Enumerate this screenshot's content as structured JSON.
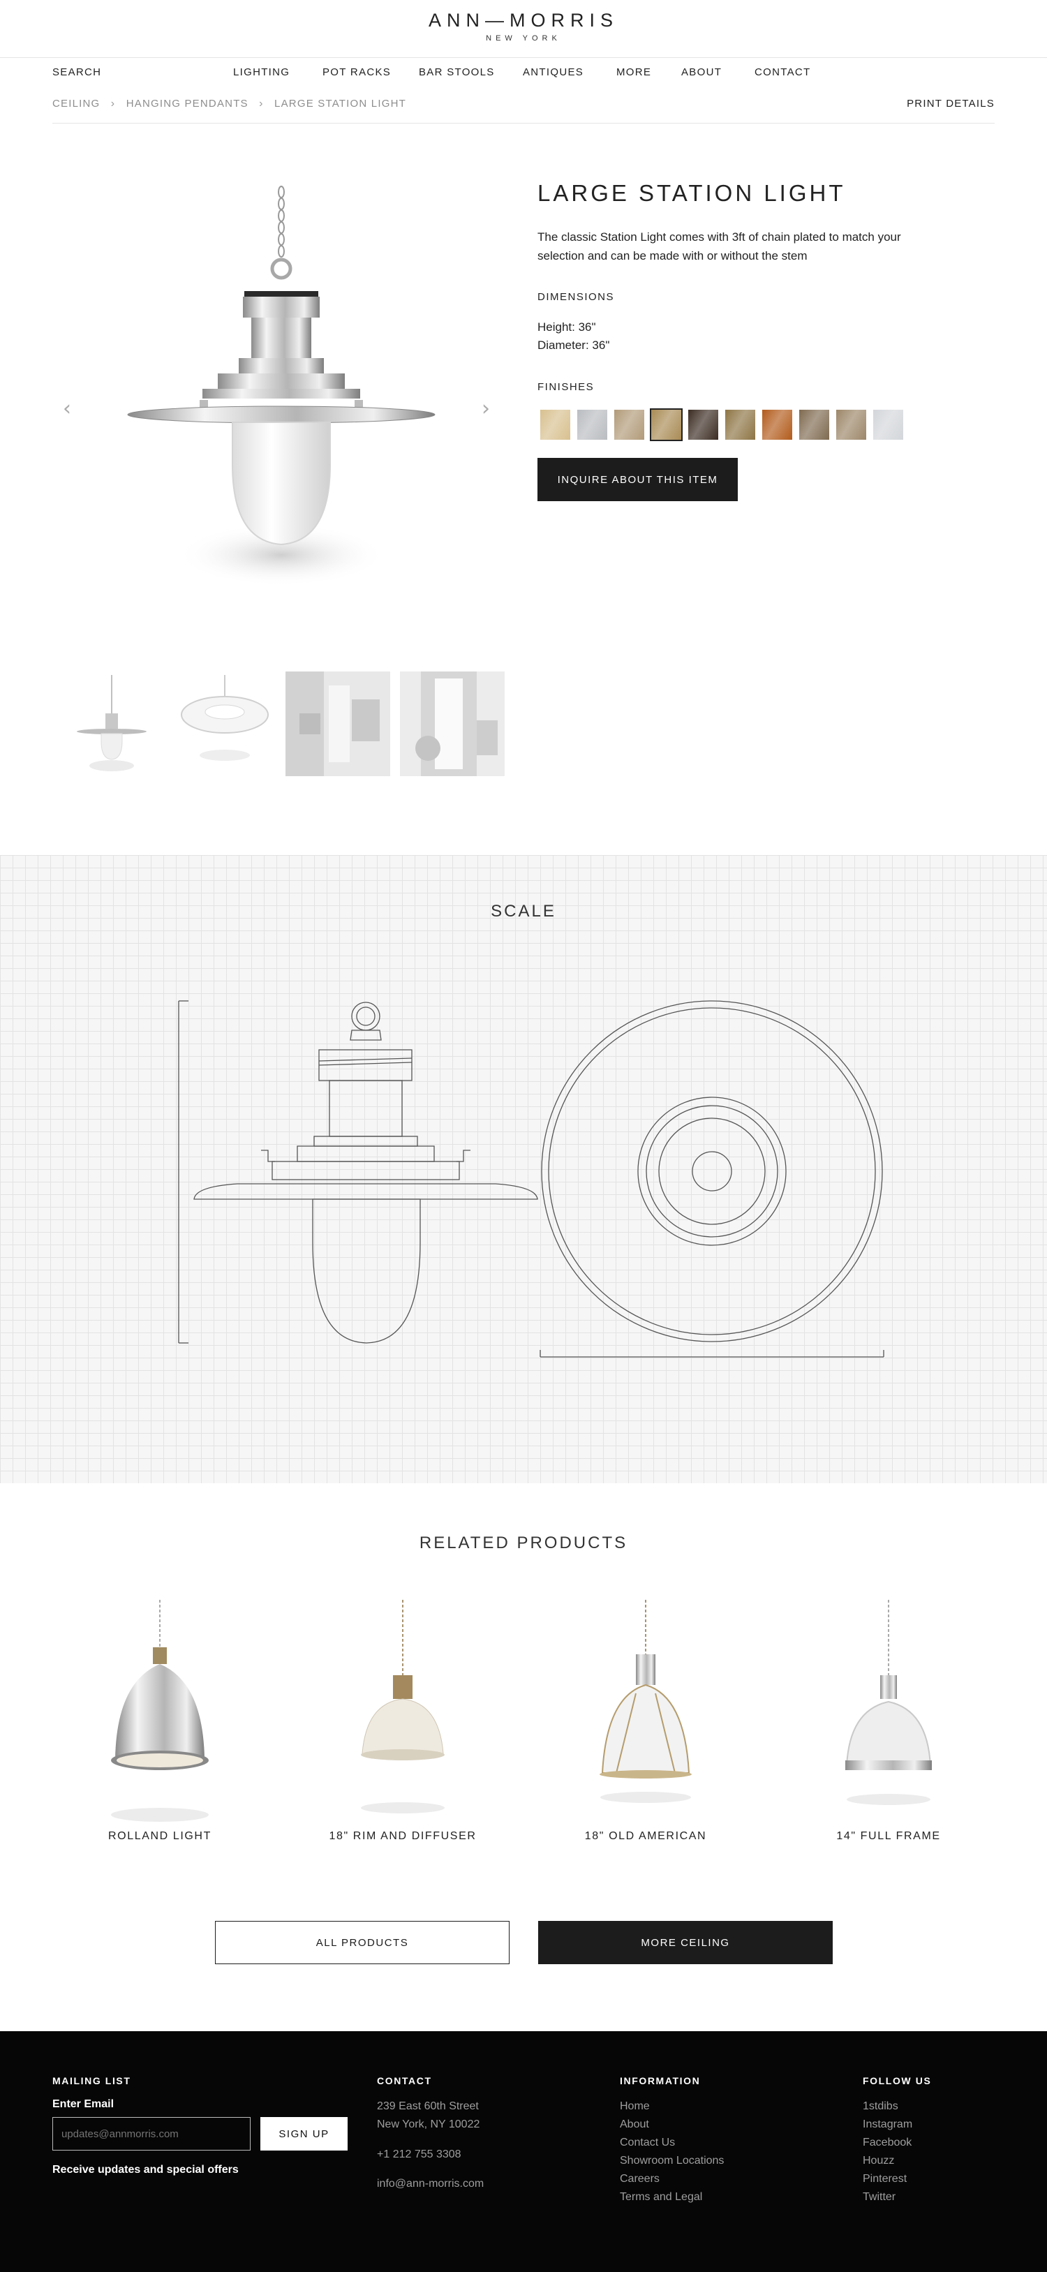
{
  "brand": {
    "name": "ANN—MORRIS",
    "tagline": "NEW YORK"
  },
  "nav": {
    "search": "SEARCH",
    "items": [
      "LIGHTING",
      "POT RACKS",
      "BAR STOOLS",
      "ANTIQUES",
      "MORE",
      "ABOUT",
      "CONTACT"
    ]
  },
  "breadcrumb": {
    "items": [
      "CEILING",
      "HANGING PENDANTS",
      "LARGE STATION LIGHT"
    ],
    "print": "PRINT DETAILS"
  },
  "product": {
    "title": "LARGE STATION LIGHT",
    "description": "The classic Station Light comes with 3ft of chain plated to match your selection and can be made with or without the stem",
    "dimensions_label": "DIMENSIONS",
    "height": "Height: 36\"",
    "diameter": "Diameter: 36\"",
    "finishes_label": "FINISHES",
    "finish_colors": [
      "#d8c08f",
      "#b9bcc0",
      "#b19a78",
      "#a98b55",
      "#3b2c22",
      "#8d7444",
      "#b25b1b",
      "#7f6a50",
      "#9c8668",
      "#d3d6da"
    ],
    "selected_finish": 3,
    "inquire": "INQUIRE ABOUT THIS ITEM",
    "prev_arrow": "chevron-left-icon",
    "next_arrow": "chevron-right-icon"
  },
  "scale": {
    "title": "SCALE"
  },
  "related": {
    "title": "RELATED PRODUCTS",
    "items": [
      "ROLLAND LIGHT",
      "18\" RIM AND DIFFUSER",
      "18\" OLD AMERICAN",
      "14\" FULL FRAME"
    ],
    "all_products": "ALL PRODUCTS",
    "more_ceiling": "MORE CEILING"
  },
  "footer": {
    "mailing": {
      "heading": "MAILING LIST",
      "label": "Enter Email",
      "placeholder": "updates@annmorris.com",
      "signup": "SIGN UP",
      "note": "Receive updates and special offers"
    },
    "contact": {
      "heading": "CONTACT",
      "address1": "239 East 60th Street",
      "address2": "New York, NY 10022",
      "phone": "+1 212 755 3308",
      "email": "info@ann-morris.com"
    },
    "information": {
      "heading": "INFORMATION",
      "links": [
        "Home",
        "About",
        "Contact Us",
        "Showroom Locations",
        "Careers",
        "Terms and Legal"
      ]
    },
    "follow": {
      "heading": "FOLLOW US",
      "links": [
        "1stdibs",
        "Instagram",
        "Facebook",
        "Houzz",
        "Pinterest",
        "Twitter"
      ]
    }
  }
}
